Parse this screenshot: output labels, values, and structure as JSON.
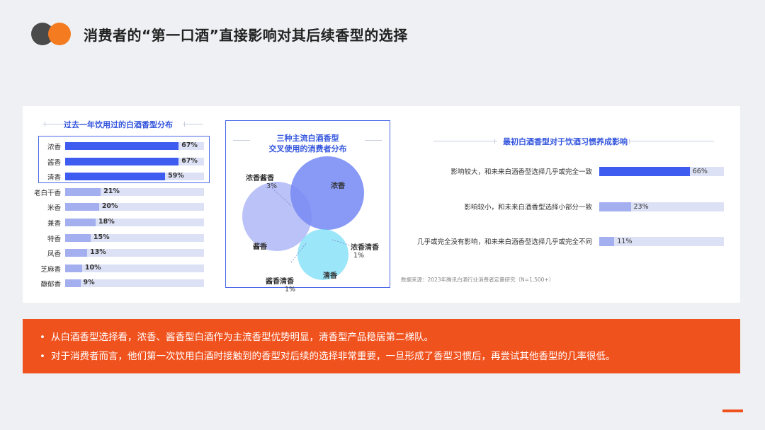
{
  "title": "消费者的“第一口酒”直接影响对其后续香型的选择",
  "colors": {
    "accent_blue": "#3f5cf0",
    "light_blue": "#a4aff0",
    "track": "#dde1f5",
    "orange": "#f0521e",
    "cyan": "#9ee7fb"
  },
  "chart_data": [
    {
      "type": "bar",
      "title": "过去一年饮用过的白酒香型分布",
      "categories": [
        "浓香",
        "酱香",
        "清香",
        "老白干香",
        "米香",
        "兼香",
        "特香",
        "凤香",
        "芝麻香",
        "馥郁香"
      ],
      "value_labels": [
        "67%",
        "67%",
        "59%",
        "21%",
        "20%",
        "18%",
        "15%",
        "13%",
        "10%",
        "9%"
      ],
      "values": [
        67,
        67,
        59,
        21,
        20,
        18,
        15,
        13,
        10,
        9
      ],
      "highlighted": [
        true,
        true,
        true,
        false,
        false,
        false,
        false,
        false,
        false,
        false
      ],
      "xlim": [
        0,
        100
      ]
    },
    {
      "type": "venn",
      "title_line1": "三种主流白酒香型",
      "title_line2": "交叉使用的消费者分布",
      "sets": [
        "浓香",
        "酱香",
        "清香"
      ],
      "overlaps": [
        {
          "label": "浓香酱香",
          "value": "3%"
        },
        {
          "label": "浓香清香",
          "value": "1%"
        },
        {
          "label": "酱香清香",
          "value": "1%"
        }
      ]
    },
    {
      "type": "bar",
      "title": "最初白酒香型对于饮酒习惯养成影响",
      "categories": [
        "影响较大，和未来白酒香型选择几乎或完全一致",
        "影响较小，和未来白酒香型选择小部分一致",
        "几乎或完全没有影响，和未来白酒香型选择几乎或完全不同"
      ],
      "value_labels": [
        "66%",
        "23%",
        "11%"
      ],
      "values": [
        66,
        23,
        11
      ],
      "xlim": [
        0,
        100
      ]
    }
  ],
  "source": "数据来源：2023年腾讯白酒行业消费者定量研究（N=1,500+）",
  "bullets": [
    "从白酒香型选择看，浓香、酱香型白酒作为主流香型优势明显，清香型产品稳居第二梯队。",
    "对于消费者而言，他们第一次饮用白酒时接触到的香型对后续的选择非常重要，一旦形成了香型习惯后，再尝试其他香型的几率很低。"
  ]
}
